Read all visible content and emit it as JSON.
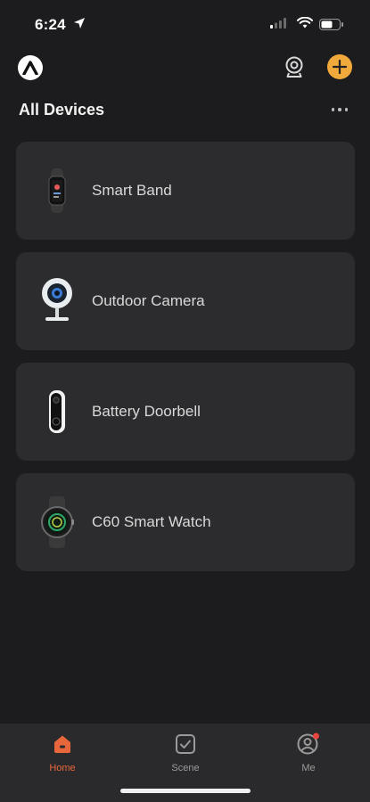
{
  "status_bar": {
    "time": "6:24"
  },
  "header": {
    "section_title": "All Devices"
  },
  "devices": [
    {
      "name": "Smart Band"
    },
    {
      "name": "Outdoor Camera"
    },
    {
      "name": "Battery Doorbell"
    },
    {
      "name": "C60 Smart Watch"
    }
  ],
  "nav": {
    "home": "Home",
    "scene": "Scene",
    "me": "Me",
    "active": "Home"
  },
  "colors": {
    "accent": "#f2a93b",
    "active_tab": "#e8663c",
    "notification_dot": "#e8453c",
    "background": "#1c1c1e",
    "card": "#2c2c2e"
  },
  "icons": {
    "header": [
      "app-logo-icon",
      "camera-icon",
      "add-icon",
      "more-icon"
    ],
    "nav": [
      "home-icon",
      "scene-icon",
      "profile-icon"
    ]
  }
}
